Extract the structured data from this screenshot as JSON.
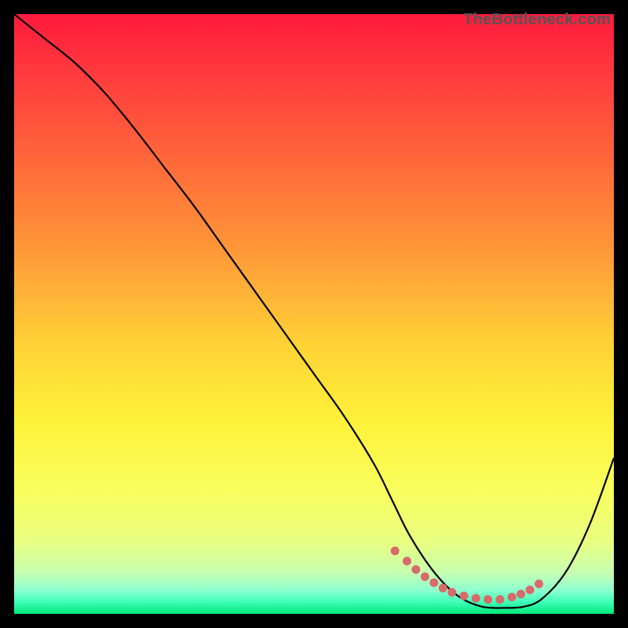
{
  "watermark": "TheBottleneck.com",
  "chart_data": {
    "type": "line",
    "title": "",
    "xlabel": "",
    "ylabel": "",
    "xlim": [
      0,
      100
    ],
    "ylim": [
      0,
      100
    ],
    "gradient_stops": [
      {
        "offset": 0,
        "color": "#ff1a3c"
      },
      {
        "offset": 10,
        "color": "#ff3b3e"
      },
      {
        "offset": 25,
        "color": "#ff6a3a"
      },
      {
        "offset": 40,
        "color": "#ff9a38"
      },
      {
        "offset": 55,
        "color": "#ffd236"
      },
      {
        "offset": 68,
        "color": "#fff23a"
      },
      {
        "offset": 80,
        "color": "#f8ff60"
      },
      {
        "offset": 88,
        "color": "#e8ff80"
      },
      {
        "offset": 93,
        "color": "#c8ffb0"
      },
      {
        "offset": 96,
        "color": "#90ffd0"
      },
      {
        "offset": 98,
        "color": "#40ffb8"
      },
      {
        "offset": 100,
        "color": "#00e878"
      }
    ],
    "series": [
      {
        "name": "bottleneck-curve",
        "x": [
          0,
          5,
          10,
          15,
          20,
          25,
          30,
          35,
          40,
          45,
          50,
          55,
          60,
          63,
          66,
          70,
          74,
          78,
          82,
          85,
          88,
          92,
          96,
          100
        ],
        "y": [
          100,
          96,
          92,
          87,
          81,
          74.5,
          68,
          61,
          54,
          47,
          40,
          33,
          25,
          19,
          13,
          7,
          3,
          1.2,
          1.0,
          1.2,
          2.5,
          7,
          15,
          26
        ]
      }
    ],
    "markers": {
      "name": "highlight-dots",
      "color": "#d96a6a",
      "x": [
        63.5,
        65.5,
        67,
        68.5,
        70,
        71.5,
        73,
        75,
        77,
        79,
        81,
        83,
        84.5,
        86,
        87.5
      ],
      "y": [
        10.5,
        8.8,
        7.4,
        6.2,
        5.2,
        4.3,
        3.6,
        3.0,
        2.6,
        2.4,
        2.4,
        2.8,
        3.3,
        4.0,
        5.0
      ]
    }
  }
}
